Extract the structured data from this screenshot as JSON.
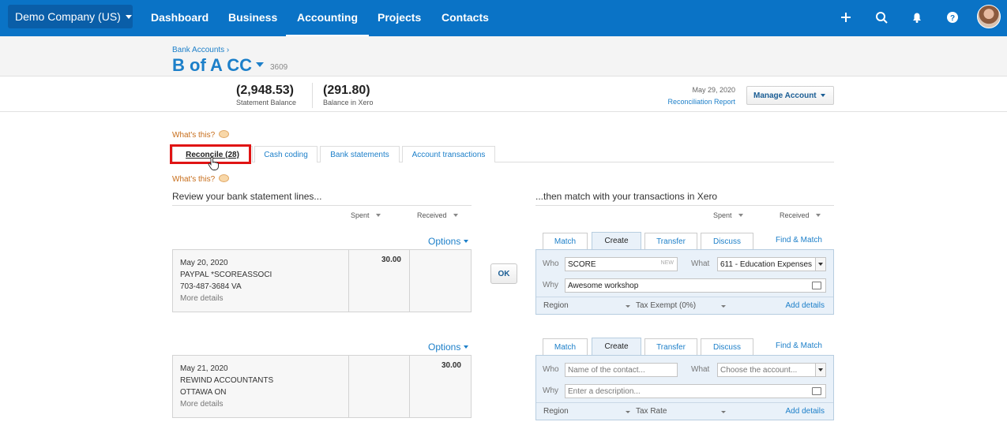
{
  "nav": {
    "org_name": "Demo Company (US)",
    "items": [
      {
        "label": "Dashboard",
        "active": false
      },
      {
        "label": "Business",
        "active": false
      },
      {
        "label": "Accounting",
        "active": true
      },
      {
        "label": "Projects",
        "active": false
      },
      {
        "label": "Contacts",
        "active": false
      }
    ],
    "icons": [
      "plus-icon",
      "search-icon",
      "bell-icon",
      "help-icon"
    ]
  },
  "header": {
    "breadcrumb": "Bank Accounts ›",
    "account_name": "B of A CC",
    "account_number": "3609"
  },
  "balances": {
    "statement_amount": "(2,948.53)",
    "statement_label": "Statement Balance",
    "xero_amount": "(291.80)",
    "xero_label": "Balance in Xero",
    "date": "May 29, 2020",
    "report_link": "Reconciliation Report",
    "manage_label": "Manage Account"
  },
  "whats_this": "What's this?",
  "tabs": [
    {
      "label": "Reconcile (28)",
      "active": true
    },
    {
      "label": "Cash coding",
      "active": false
    },
    {
      "label": "Bank statements",
      "active": false
    },
    {
      "label": "Account transactions",
      "active": false
    }
  ],
  "left_title": "Review your bank statement lines...",
  "right_title": "...then match with your transactions in Xero",
  "col_spent": "Spent",
  "col_received": "Received",
  "options_label": "Options",
  "ok_label": "OK",
  "match_tabs": [
    "Match",
    "Create",
    "Transfer",
    "Discuss"
  ],
  "find_match": "Find & Match",
  "labels": {
    "who": "Who",
    "what": "What",
    "why": "Why",
    "new_tag": "NEW",
    "region": "Region",
    "add_details": "Add details"
  },
  "lines": [
    {
      "date": "May 20, 2020",
      "payee": "PAYPAL *SCOREASSOCI",
      "ref": "703-487-3684 VA",
      "more": "More details",
      "spent": "30.00",
      "received": "",
      "who": "SCORE",
      "what": "611 - Education Expenses",
      "why": "Awesome workshop",
      "tax": "Tax Exempt (0%)"
    },
    {
      "date": "May 21, 2020",
      "payee": "REWIND ACCOUNTANTS",
      "ref": "OTTAWA ON",
      "more": "More details",
      "spent": "",
      "received": "30.00",
      "who": "Name of the contact...",
      "what": "Choose the account...",
      "why": "Enter a description...",
      "tax": "Tax Rate"
    }
  ]
}
